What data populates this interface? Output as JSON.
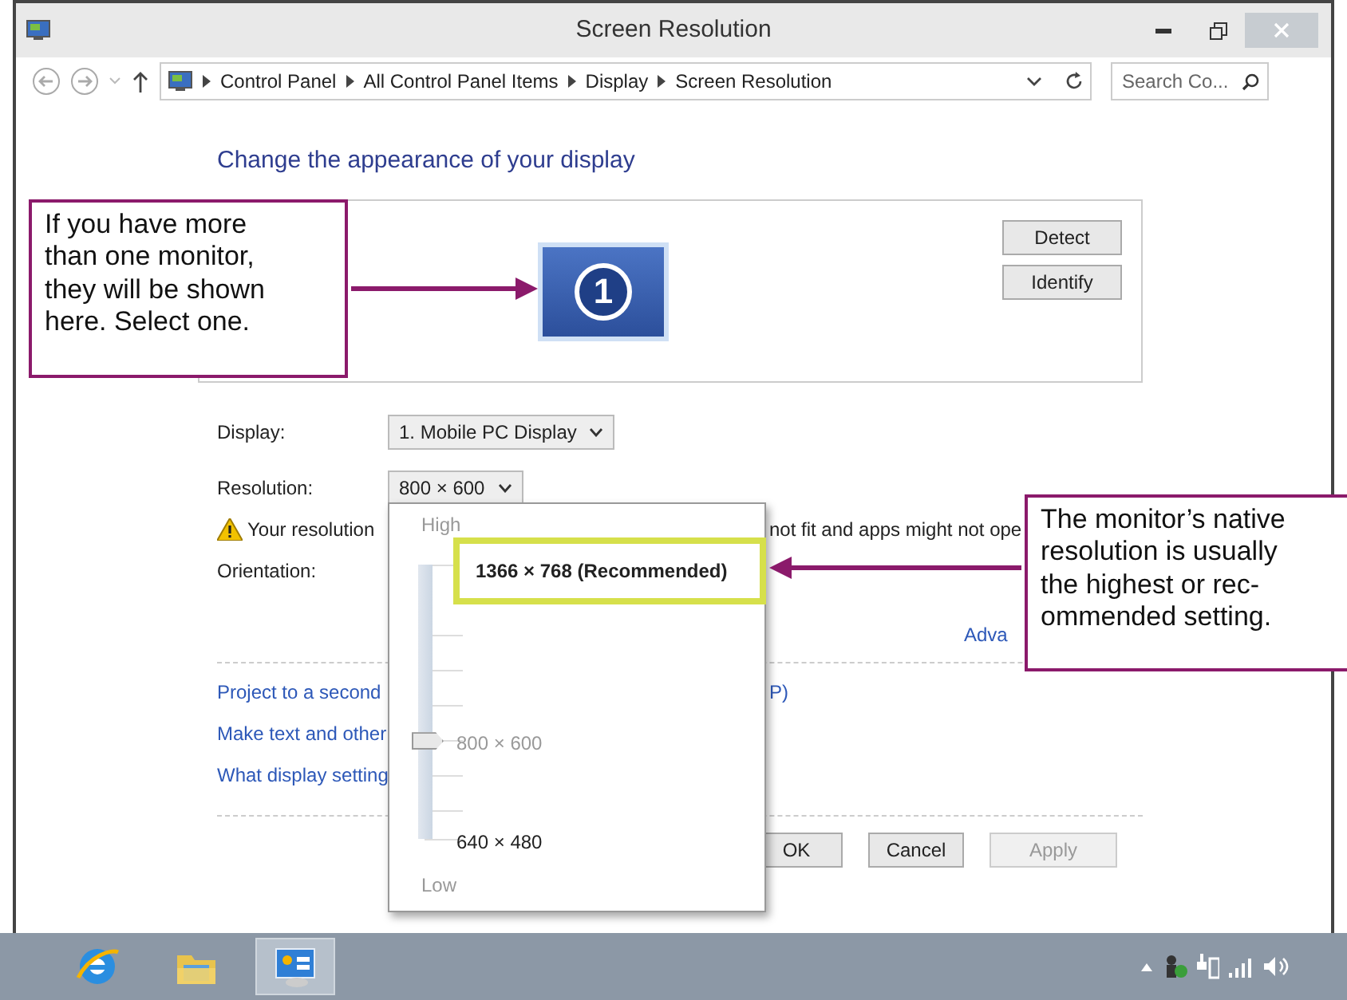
{
  "window": {
    "title": "Screen Resolution"
  },
  "address_bar": {
    "breadcrumb": [
      "Control Panel",
      "All Control Panel Items",
      "Display",
      "Screen Resolution"
    ],
    "search": {
      "placeholder": "Search Co..."
    }
  },
  "heading": "Change the appearance of your display",
  "monitor_panel": {
    "monitors": [
      {
        "label": "1",
        "selected": true
      }
    ],
    "buttons": [
      "Detect",
      "Identify"
    ]
  },
  "settings": [
    {
      "label": "Display:",
      "value": "1. Mobile PC Display"
    },
    {
      "label": "Resolution:",
      "value": "800 × 600"
    }
  ],
  "warning": {
    "text_start": "Your resolution",
    "text_end": "not fit and apps might not ope"
  },
  "orientation": {
    "label": "Orientation:"
  },
  "advanced_link": "Adva",
  "links": [
    {
      "text": "Project to a second",
      "tail": "P)"
    },
    {
      "text": "Make text and other"
    },
    {
      "text": "What display setting"
    }
  ],
  "buttons": [
    {
      "label": "OK",
      "disabled": false
    },
    {
      "label": "Cancel",
      "disabled": false
    },
    {
      "label": "Apply",
      "disabled": true
    }
  ],
  "resolution_popup": {
    "high_label": "High",
    "low_label": "Low",
    "level": 0.36,
    "options": [
      {
        "label": "1366 × 768 (Recommended)",
        "highlighted": true,
        "selected": false
      },
      {
        "label": "800 × 600",
        "highlighted": false,
        "selected": true
      },
      {
        "label": "640 × 480",
        "highlighted": false,
        "selected": false
      }
    ]
  },
  "callouts": [
    {
      "lines": [
        "If you have more",
        "than one monitor,",
        "they will be shown",
        "here. Select one."
      ]
    },
    {
      "lines": [
        "The monitor’s native",
        "resolution is usually",
        "the highest or rec-",
        "ommended setting."
      ]
    }
  ],
  "taskbar": {
    "apps": [
      {
        "kind": "browser",
        "selected": false
      },
      {
        "kind": "folder",
        "selected": false
      },
      {
        "kind": "display",
        "selected": true
      }
    ]
  }
}
